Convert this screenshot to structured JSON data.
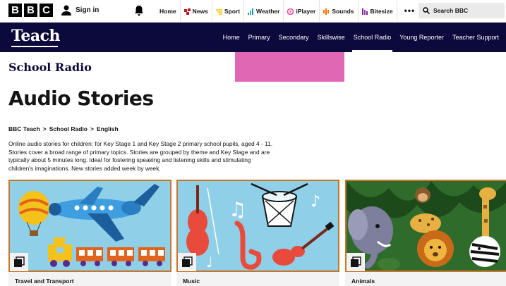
{
  "global_bar": {
    "logo_letters": [
      "B",
      "B",
      "C"
    ],
    "signin_label": "Sign in",
    "nav": [
      {
        "label": "Home",
        "icon": "none",
        "color": ""
      },
      {
        "label": "News",
        "icon": "news-icon",
        "color": "#c4161c"
      },
      {
        "label": "Sport",
        "icon": "sport-icon",
        "color": "#ffd230"
      },
      {
        "label": "Weather",
        "icon": "weather-icon",
        "color": "#1a8fd8"
      },
      {
        "label": "iPlayer",
        "icon": "iplayer-icon",
        "color": "#f54997"
      },
      {
        "label": "Sounds",
        "icon": "sounds-icon",
        "color": "#ff6a00"
      },
      {
        "label": "Bitesize",
        "icon": "bitesize-icon",
        "color": "#7b2b8f"
      }
    ],
    "more_label": "•••",
    "search_placeholder": "Search BBC"
  },
  "teach_bar": {
    "logo": "Teach",
    "nav": [
      "Home",
      "Primary",
      "Secondary",
      "Skillswise",
      "School Radio",
      "Young Reporter",
      "Teacher Support"
    ],
    "active": "School Radio"
  },
  "main": {
    "section_title": "School Radio",
    "page_title": "Audio Stories",
    "breadcrumb": [
      "BBC Teach",
      ">",
      "School Radio",
      ">",
      "English"
    ],
    "description": "Online audio stories for children: for Key Stage 1 and Key Stage 2 primary school pupils, aged 4 - 11. Stories cover a broad range of primary topics. Stories are grouped by theme and Key Stage and are typically about 5 minutes long. Ideal for fostering speaking and listening skills and stimulating children's imaginations. New stories added week by week."
  },
  "cards": [
    {
      "label": "Travel and Transport",
      "icon": "collection-icon"
    },
    {
      "label": "Music",
      "icon": "collection-icon"
    },
    {
      "label": "Animals",
      "icon": "collection-icon"
    }
  ],
  "colors": {
    "teach_bar_bg": "#0c0a3c",
    "card_border": "#c9762d",
    "accent_pink": "#e067b4"
  }
}
